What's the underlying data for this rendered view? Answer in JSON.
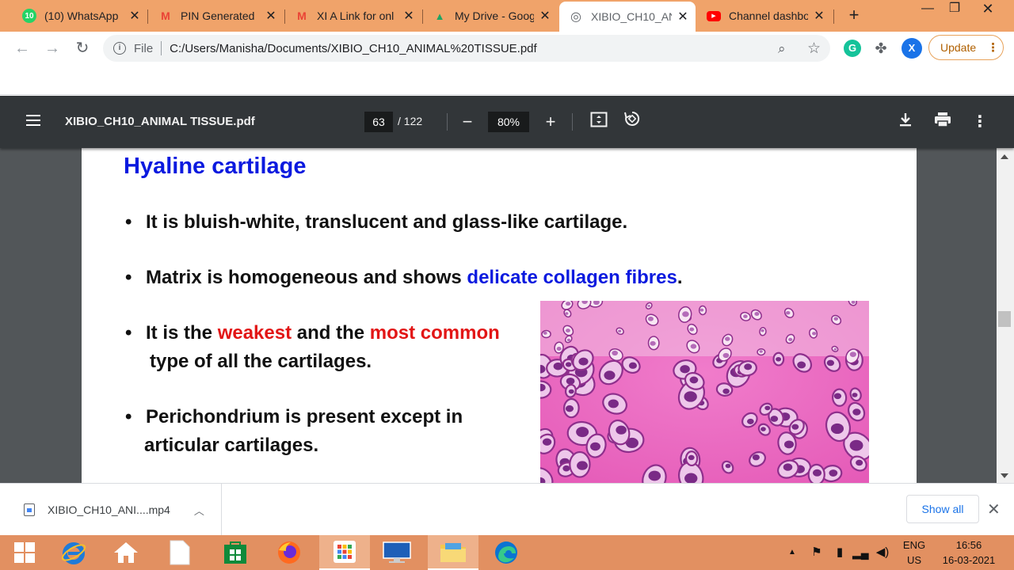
{
  "tabs": [
    {
      "label": "(10) WhatsApp",
      "icon": "whatsapp-icon",
      "color": "#25d366",
      "badge": "10"
    },
    {
      "label": "PIN Generated",
      "icon": "gmail-icon",
      "color": "#ea4335",
      "badge": "M"
    },
    {
      "label": "XI A Link for onl",
      "icon": "gmail-icon",
      "color": "#ea4335",
      "badge": "M"
    },
    {
      "label": "My Drive - Goog",
      "icon": "google-drive-icon",
      "color": "#1fa463",
      "badge": "▲"
    },
    {
      "label": "XIBIO_CH10_AN",
      "icon": "globe-icon",
      "color": "#5f6368",
      "badge": "◎"
    },
    {
      "label": "Channel dashbo",
      "icon": "youtube-icon",
      "color": "#ff0000",
      "badge": "▶"
    }
  ],
  "address": {
    "scheme_label": "File",
    "url": "C:/Users/Manisha/Documents/XIBIO_CH10_ANIMAL%20TISSUE.pdf"
  },
  "profile": {
    "initial": "X",
    "update_label": "Update"
  },
  "pdf": {
    "title": "XIBIO_CH10_ANIMAL TISSUE.pdf",
    "page": "63",
    "total": "/ 122",
    "zoom": "80%"
  },
  "slide": {
    "title": "Hyaline cartilage",
    "bullet_dot": "•",
    "b1": "It is bluish-white, translucent and glass-like cartilage.",
    "b2_a": "Matrix is homogeneous and shows ",
    "b2_b": "delicate collagen fibres",
    "b2_c": ".",
    "b3_a": "It is the ",
    "b3_b": "weakest",
    "b3_c": " and the ",
    "b3_d": "most common",
    "b3_e": "type of all the cartilages.",
    "b4_a": "Perichondrium is present except in",
    "b4_b": "articular cartilages."
  },
  "download": {
    "filename": "XIBIO_CH10_ANI....mp4",
    "show_all": "Show all"
  },
  "tray": {
    "lang1": "ENG",
    "lang2": "US",
    "time": "16:56",
    "date": "16-03-2021"
  },
  "colors": {
    "tabstrip": "#f0a36a",
    "taskbar": "#e29061",
    "pdf_toolbar": "#323639",
    "slide_title": "#0b1adf",
    "highlight_red": "#e21616"
  }
}
